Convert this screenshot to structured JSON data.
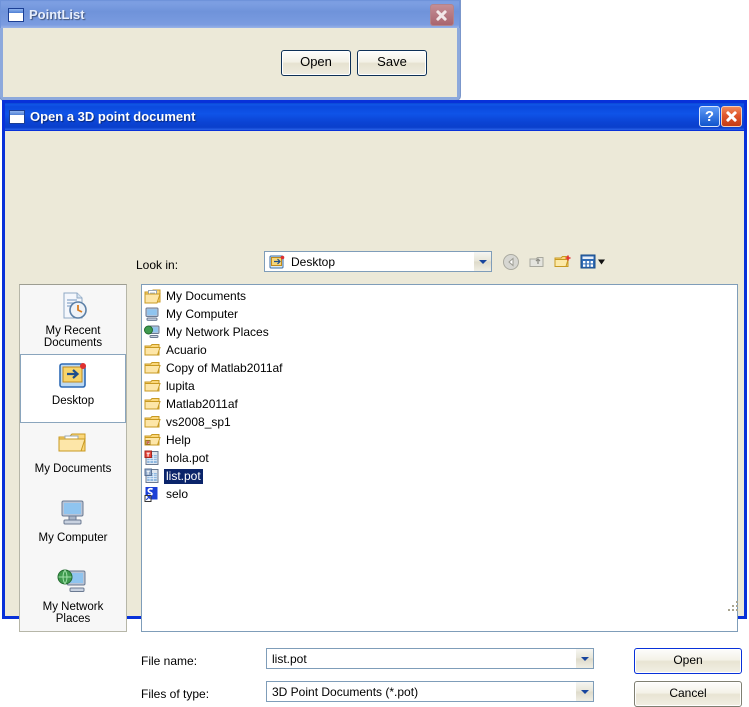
{
  "pointlist_window": {
    "title": "PointList",
    "icon": "window-icon",
    "close_label": "Close",
    "buttons": [
      {
        "label": "Open",
        "name": "open-button"
      },
      {
        "label": "Save",
        "name": "save-button"
      }
    ]
  },
  "open_dialog": {
    "title": "Open a 3D point document",
    "icon": "window-icon",
    "titlebar_buttons": [
      {
        "name": "help-button",
        "glyph": "?"
      },
      {
        "name": "close-button",
        "glyph": "x"
      }
    ],
    "lookin": {
      "label": "Look in:",
      "value": "Desktop",
      "icon": "desktop-icon"
    },
    "nav_icons": [
      {
        "name": "back-icon",
        "title": "Back"
      },
      {
        "name": "up-one-level-icon",
        "title": "Up One Level"
      },
      {
        "name": "new-folder-icon",
        "title": "Create New Folder"
      },
      {
        "name": "views-icon",
        "title": "Views"
      }
    ],
    "places": [
      {
        "label": "My Recent\nDocuments",
        "icon": "recent-documents-icon",
        "selected": false
      },
      {
        "label": "Desktop",
        "icon": "desktop-icon",
        "selected": true
      },
      {
        "label": "My Documents",
        "icon": "my-documents-icon",
        "selected": false
      },
      {
        "label": "My Computer",
        "icon": "my-computer-icon",
        "selected": false
      },
      {
        "label": "My Network\nPlaces",
        "icon": "my-network-places-icon",
        "selected": false
      }
    ],
    "files": [
      {
        "name": "My Documents",
        "icon": "my-documents-icon",
        "selected": false
      },
      {
        "name": "My Computer",
        "icon": "my-computer-icon",
        "selected": false
      },
      {
        "name": "My Network Places",
        "icon": "my-network-places-icon",
        "selected": false
      },
      {
        "name": "Acuario",
        "icon": "folder-icon",
        "selected": false
      },
      {
        "name": "Copy of Matlab2011af",
        "icon": "folder-icon",
        "selected": false
      },
      {
        "name": "lupita",
        "icon": "folder-icon",
        "selected": false
      },
      {
        "name": "Matlab2011af",
        "icon": "folder-icon",
        "selected": false
      },
      {
        "name": "vs2008_sp1",
        "icon": "folder-icon",
        "selected": false
      },
      {
        "name": "Help",
        "icon": "special-folder-icon",
        "selected": false
      },
      {
        "name": "hola.pot",
        "icon": "pot-file-icon",
        "selected": false
      },
      {
        "name": "list.pot",
        "icon": "pot-file-icon",
        "selected": true
      },
      {
        "name": "selo",
        "icon": "shortcut-icon",
        "selected": false
      }
    ],
    "filename_field": {
      "label": "File name:",
      "value": "list.pot",
      "placeholder": ""
    },
    "filetype_field": {
      "label": "Files of type:",
      "value": "3D Point Documents (*.pot)",
      "options": [
        "3D Point Documents (*.pot)"
      ]
    },
    "action_buttons": [
      {
        "label": "Open",
        "name": "open-button",
        "default": true
      },
      {
        "label": "Cancel",
        "name": "cancel-button",
        "default": false
      }
    ]
  },
  "colors": {
    "active_title": "#0b4ade",
    "inactive_title": "#7a9ce0",
    "dialog_face": "#ece9d8",
    "selection": "#0a246a",
    "dialog_border": "#0831d9"
  }
}
